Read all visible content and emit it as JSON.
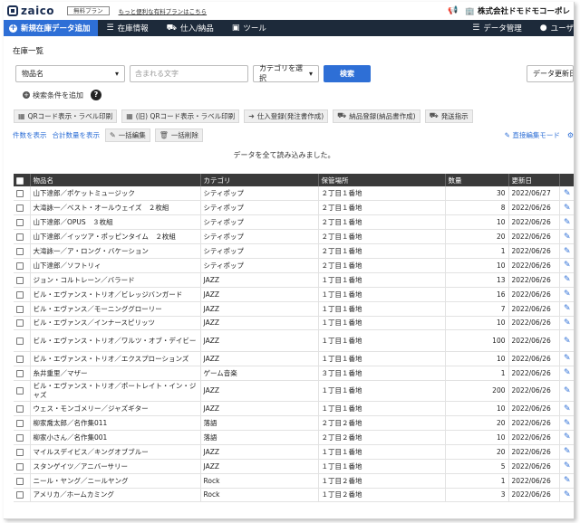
{
  "header": {
    "logo_text": "zaico",
    "free_badge": "無料プラン",
    "upgrade_link": "もっと便利な有料プランはこちら",
    "notice_icon": "megaphone-icon",
    "company_name": "株式会社ドモドモコーポレ"
  },
  "nav": {
    "new_item": "新規在庫データ追加",
    "items": [
      {
        "label": "在庫情報",
        "icon": "list-icon"
      },
      {
        "label": "仕入/納品",
        "icon": "truck-icon"
      },
      {
        "label": "ツール",
        "icon": "briefcase-icon"
      }
    ],
    "data_manage": "データ管理",
    "user": "ユーザ"
  },
  "page": {
    "title": "在庫一覧"
  },
  "search": {
    "field_select": "物品名",
    "keyword_placeholder": "含まれる文字",
    "category_select": "カテゴリを選択",
    "search_button": "検索",
    "update_sort": "データ更新日",
    "add_condition": "検索条件を追加",
    "help": "?"
  },
  "actions": [
    {
      "label": "QRコード表示・ラベル印刷",
      "icon": "qr-icon"
    },
    {
      "label": "(旧) QRコード表示・ラベル印刷",
      "icon": "qr-icon"
    },
    {
      "label": "仕入登録(発注書作成)",
      "icon": "inbound-icon"
    },
    {
      "label": "納品登録(納品書作成)",
      "icon": "outbound-icon"
    },
    {
      "label": "発送指示",
      "icon": "shipping-icon"
    }
  ],
  "links": {
    "show_count": "件数を表示",
    "show_total": "合計数量を表示",
    "bulk_edit": "一括編集",
    "bulk_delete": "一括削除",
    "direct_edit": "直接編集モード"
  },
  "status": {
    "loaded": "データを全て読み込みました。"
  },
  "table": {
    "columns": [
      "物品名",
      "カテゴリ",
      "保管場所",
      "数量",
      "更新日"
    ],
    "rows": [
      {
        "name": "山下達郎／ポケットミュージック",
        "category": "シティポップ",
        "location": "２丁目１番地",
        "qty": "30",
        "date": "2022/06/27"
      },
      {
        "name": "大滝詠一／ベスト・オールウェイズ　２枚組",
        "category": "シティポップ",
        "location": "２丁目１番地",
        "qty": "8",
        "date": "2022/06/26"
      },
      {
        "name": "山下達郎／OPUS　３枚組",
        "category": "シティポップ",
        "location": "２丁目１番地",
        "qty": "10",
        "date": "2022/06/26"
      },
      {
        "name": "山下達郎／イッツア・ポッピンタイム　２枚組",
        "category": "シティポップ",
        "location": "２丁目１番地",
        "qty": "20",
        "date": "2022/06/26"
      },
      {
        "name": "大滝詠一／ア・ロング・バケーション",
        "category": "シティポップ",
        "location": "２丁目１番地",
        "qty": "1",
        "date": "2022/06/26"
      },
      {
        "name": "山下達郎／ソフトリィ",
        "category": "シティポップ",
        "location": "２丁目１番地",
        "qty": "10",
        "date": "2022/06/26"
      },
      {
        "name": "ジョン・コルトレーン／バラード",
        "category": "JAZZ",
        "location": "１丁目１番地",
        "qty": "13",
        "date": "2022/06/26"
      },
      {
        "name": "ビル・エヴァンス・トリオ／ビレッジバンガード",
        "category": "JAZZ",
        "location": "１丁目１番地",
        "qty": "16",
        "date": "2022/06/26"
      },
      {
        "name": "ビル・エヴァンス／モーニンググローリー",
        "category": "JAZZ",
        "location": "１丁目１番地",
        "qty": "7",
        "date": "2022/06/26"
      },
      {
        "name": "ビル・エヴァンス／インナースピリッツ",
        "category": "JAZZ",
        "location": "１丁目１番地",
        "qty": "10",
        "date": "2022/06/26"
      },
      {
        "name": "ビル・エヴァンス・トリオ／ワルツ・オブ・デイビー",
        "category": "JAZZ",
        "location": "１丁目１番地",
        "qty": "100",
        "date": "2022/06/26",
        "tall": true
      },
      {
        "name": "ビル・エヴァンス・トリオ／エクスプローションズ",
        "category": "JAZZ",
        "location": "１丁目１番地",
        "qty": "10",
        "date": "2022/06/26"
      },
      {
        "name": "糸井重里／マザー",
        "category": "ゲーム音楽",
        "location": "３丁目１番地",
        "qty": "1",
        "date": "2022/06/26"
      },
      {
        "name": "ビル・エヴァンス・トリオ／ポートレイト・イン・ジャズ",
        "category": "JAZZ",
        "location": "１丁目１番地",
        "qty": "200",
        "date": "2022/06/26",
        "tall": true
      },
      {
        "name": "ウェス・モンゴメリー／ジャズギター",
        "category": "JAZZ",
        "location": "１丁目１番地",
        "qty": "10",
        "date": "2022/06/26"
      },
      {
        "name": "柳家喬太郎／名作集011",
        "category": "落語",
        "location": "２丁目２番地",
        "qty": "20",
        "date": "2022/06/26"
      },
      {
        "name": "柳家小さん／名作集001",
        "category": "落語",
        "location": "２丁目２番地",
        "qty": "10",
        "date": "2022/06/26"
      },
      {
        "name": "マイルスデイビス／キングオブブルー",
        "category": "JAZZ",
        "location": "１丁目１番地",
        "qty": "20",
        "date": "2022/06/26"
      },
      {
        "name": "スタンゲイツ／アニバーサリー",
        "category": "JAZZ",
        "location": "１丁目１番地",
        "qty": "5",
        "date": "2022/06/26"
      },
      {
        "name": "ニール・ヤング／ニールヤング",
        "category": "Rock",
        "location": "１丁目２番地",
        "qty": "1",
        "date": "2022/06/26"
      },
      {
        "name": "アメリカ／ホームカミング",
        "category": "Rock",
        "location": "１丁目２番地",
        "qty": "3",
        "date": "2022/06/26"
      }
    ]
  },
  "colors": {
    "brand_blue": "#2e6fd6",
    "nav_dark": "#1d2a3a",
    "table_header": "#3a3a3a"
  }
}
